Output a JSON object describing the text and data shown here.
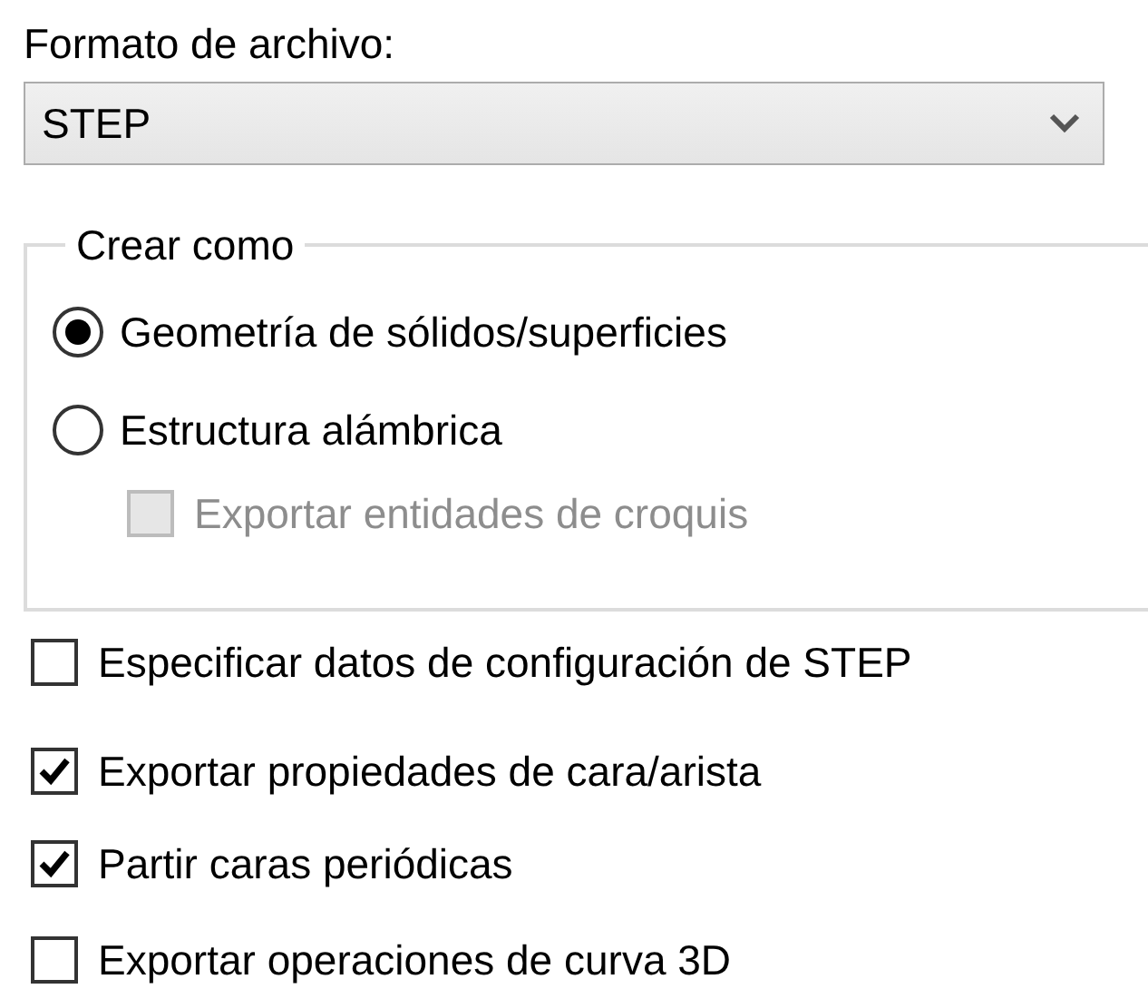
{
  "file_format": {
    "label": "Formato de archivo:",
    "value": "STEP"
  },
  "create_as": {
    "title": "Crear como",
    "options": [
      {
        "label": "Geometría de sólidos/superficies",
        "selected": true
      },
      {
        "label": "Estructura alámbrica",
        "selected": false
      }
    ],
    "sub_option": {
      "label": "Exportar entidades de croquis",
      "checked": false,
      "disabled": true
    }
  },
  "options": [
    {
      "label": "Especificar datos de configuración de STEP",
      "checked": false
    },
    {
      "label": "Exportar propiedades de cara/arista",
      "checked": true
    },
    {
      "label": "Partir caras periódicas",
      "checked": true
    },
    {
      "label": "Exportar operaciones de curva 3D",
      "checked": false
    }
  ]
}
